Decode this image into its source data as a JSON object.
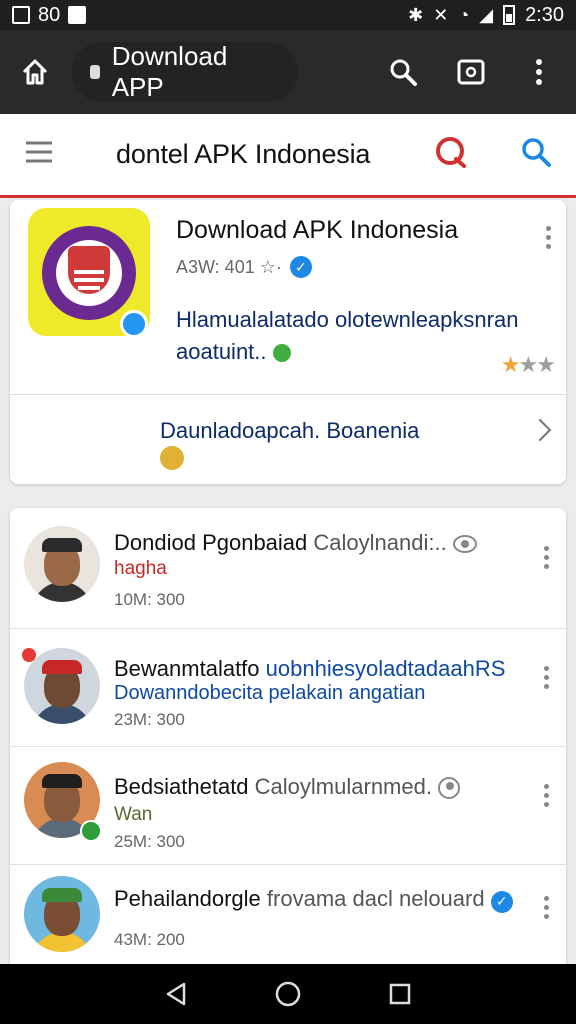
{
  "status_bar": {
    "left_text": "80",
    "time": "2:30"
  },
  "browser": {
    "url": "Download APP"
  },
  "header": {
    "title": "dontel APK Indonesia"
  },
  "featured": {
    "title": "Download APK Indonesia",
    "meta": "A3W: 401 ☆·",
    "description_line1": "Hlamualalatado olotewnleapksnran",
    "description_line2": "aoatuint..",
    "link_text": "Daunladoapcah. Boanenia"
  },
  "list": [
    {
      "title": "Dondiod Pgonbaiad",
      "extra": "Caloylnandi:..",
      "sub": "hagha",
      "time": "10M: 300"
    },
    {
      "title": "Bewanmtalatfo",
      "extra": "uobnhiesyoladtadaahRS",
      "sub": "Dowanndobecita pelakain angatian",
      "time": "23M: 300"
    },
    {
      "title": "Bedsiathetatd",
      "extra": "Caloylmularnmed.",
      "sub": "Wan",
      "time": "25M: 300"
    },
    {
      "title": "Pehailandorgle",
      "extra": "frovama dacl nelouard",
      "sub": "",
      "time": "43M: 200"
    }
  ],
  "colors": {
    "accent_red": "#d13131",
    "link_blue": "#1e88e5",
    "text_navy": "#0d2b6b"
  }
}
